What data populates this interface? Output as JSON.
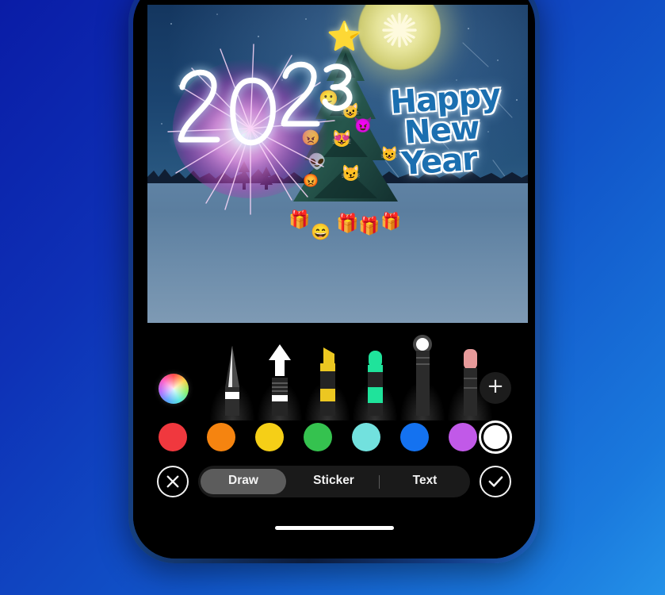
{
  "app": {
    "screen_name": "Photo Markup Editor",
    "device": "smartphone",
    "background_gradient": [
      "#0a1ca6",
      "#2491e8"
    ]
  },
  "photo": {
    "scene_description": "Night winter landscape with decorated Christmas tree, snow field, distant pine treeline and moon",
    "moon": {
      "name": "moon",
      "color": "#e6e49a"
    },
    "sky_color": "#1b4470",
    "snow_color": "#6d8dab",
    "drawing_annotation": {
      "name": "fireworks-2023-doodle",
      "text": "2023",
      "stroke_colors": [
        "#ffffff",
        "#e84bd2"
      ]
    },
    "greeting_text": {
      "line1": "Happy",
      "line2": "New",
      "line3": "Year"
    },
    "greeting_color": "#1b6fb0",
    "greeting_outline_color": "#ffffff",
    "stickers": [
      {
        "name": "sticker-star-face-topper",
        "emoji": "⭐",
        "color": "#f5d042"
      },
      {
        "name": "sticker-ornament-yellow",
        "emoji": "🙂",
        "color": "#f2c33c"
      },
      {
        "name": "sticker-ornament-purple",
        "emoji": "😺",
        "color": "#b15ad8"
      },
      {
        "name": "sticker-ornament-red",
        "emoji": "😈",
        "color": "#d93b3b"
      },
      {
        "name": "sticker-ornament-pink",
        "emoji": "😻",
        "color": "#e85c9a"
      },
      {
        "name": "sticker-ornament-green",
        "emoji": "👽",
        "color": "#3fbf6a"
      },
      {
        "name": "sticker-ornament-cream",
        "emoji": "😼",
        "color": "#efe3c4"
      },
      {
        "name": "sticker-gift-red",
        "emoji": "🎁",
        "color": "#e23b3b"
      },
      {
        "name": "sticker-gift-orange",
        "emoji": "🎁",
        "color": "#e8a24a"
      },
      {
        "name": "sticker-gift-pink",
        "emoji": "🎁",
        "color": "#e84bd2"
      },
      {
        "name": "sticker-gift-yellow",
        "emoji": "😃",
        "color": "#f2c33c"
      }
    ]
  },
  "toolbar": {
    "color_wheel_label": "Color picker",
    "add_button_label": "+",
    "tools": [
      {
        "name": "pen-tool",
        "label": "Pen",
        "tip_color": "#ffffff",
        "selected": false
      },
      {
        "name": "marker-tool",
        "label": "Marker",
        "tip_color": "#ffffff",
        "selected": false
      },
      {
        "name": "highlighter-tool",
        "label": "Highlighter",
        "tip_color": "#ecc721",
        "selected": false
      },
      {
        "name": "brush-tool",
        "label": "Brush",
        "tip_color": "#1fe39b",
        "selected": false
      },
      {
        "name": "neon-pen-tool",
        "label": "Neon",
        "tip_color": "#ffffff",
        "selected": true
      },
      {
        "name": "eraser-tool",
        "label": "Eraser",
        "tip_color": "#e79a9a",
        "selected": false
      }
    ],
    "swatches": [
      {
        "name": "swatch-red",
        "color": "#f0383e",
        "selected": false
      },
      {
        "name": "swatch-orange",
        "color": "#f58410",
        "selected": false
      },
      {
        "name": "swatch-yellow",
        "color": "#f5cf17",
        "selected": false
      },
      {
        "name": "swatch-green",
        "color": "#35c24f",
        "selected": false
      },
      {
        "name": "swatch-cyan",
        "color": "#72e1de",
        "selected": false
      },
      {
        "name": "swatch-blue",
        "color": "#1472f0",
        "selected": false
      },
      {
        "name": "swatch-purple",
        "color": "#c159e8",
        "selected": false
      },
      {
        "name": "swatch-white",
        "color": "#ffffff",
        "selected": true
      }
    ]
  },
  "bottom_bar": {
    "cancel_label": "Cancel",
    "confirm_label": "Done",
    "tabs": [
      {
        "name": "tab-draw",
        "label": "Draw",
        "active": true
      },
      {
        "name": "tab-sticker",
        "label": "Sticker",
        "active": false
      },
      {
        "name": "tab-text",
        "label": "Text",
        "active": false
      }
    ]
  }
}
